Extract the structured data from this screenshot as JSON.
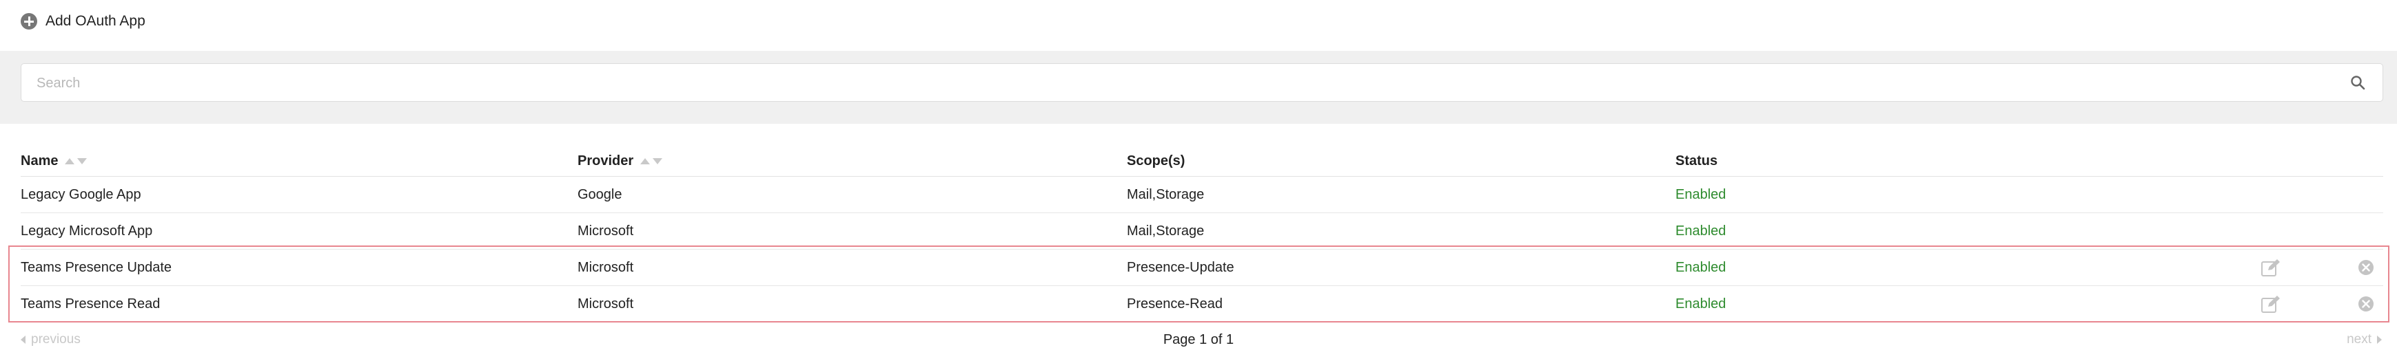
{
  "toolbar": {
    "add_label": "Add OAuth App",
    "add_icon": "plus-circle-icon"
  },
  "search": {
    "placeholder": "Search",
    "value": "",
    "icon": "search-icon"
  },
  "table": {
    "columns": [
      {
        "label": "Name",
        "sortable": true
      },
      {
        "label": "Provider",
        "sortable": true
      },
      {
        "label": "Scope(s)",
        "sortable": false
      },
      {
        "label": "Status",
        "sortable": false
      }
    ],
    "rows": [
      {
        "name": "Legacy Google App",
        "provider": "Google",
        "scopes": "Mail,Storage",
        "status": "Enabled",
        "actions": false
      },
      {
        "name": "Legacy Microsoft App",
        "provider": "Microsoft",
        "scopes": "Mail,Storage",
        "status": "Enabled",
        "actions": false
      },
      {
        "name": "Teams Presence Update",
        "provider": "Microsoft",
        "scopes": "Presence-Update",
        "status": "Enabled",
        "actions": true
      },
      {
        "name": "Teams Presence Read",
        "provider": "Microsoft",
        "scopes": "Presence-Read",
        "status": "Enabled",
        "actions": true
      }
    ]
  },
  "pagination": {
    "previous": "previous",
    "next": "next",
    "page_info": "Page 1 of 1"
  },
  "colors": {
    "accent_status": "#2e8b2e",
    "highlight": "#e8868f",
    "band": "#f0f0f0"
  }
}
